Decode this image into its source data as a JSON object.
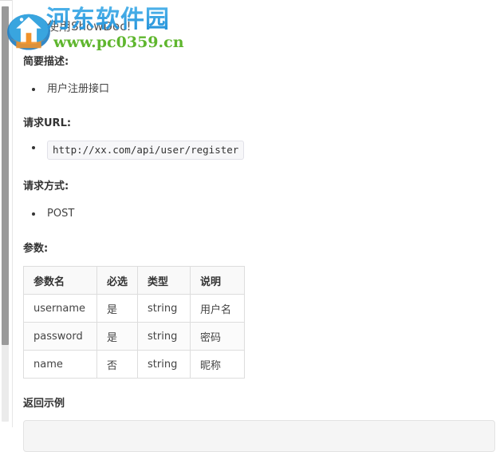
{
  "window": {
    "background": "#ffffff",
    "scrollbar": {
      "name": "vertical-scrollbar",
      "track_color": "#ebebeb",
      "thumb_color": "#9a9a9a"
    }
  },
  "document": {
    "page_title": "欢迎使用ShowDoc!",
    "sections": [
      {
        "heading": "简要描述:",
        "items": [
          "用户注册接口"
        ]
      },
      {
        "heading": "请求URL:",
        "code_items": [
          "http://xx.com/api/user/register"
        ]
      },
      {
        "heading": "请求方式:",
        "items": [
          "POST"
        ]
      },
      {
        "heading": "参数:"
      }
    ],
    "params_table": {
      "headers": [
        "参数名",
        "必选",
        "类型",
        "说明"
      ],
      "rows": [
        [
          "username",
          "是",
          "string",
          "用户名"
        ],
        [
          "password",
          "是",
          "string",
          "密码"
        ],
        [
          "name",
          "否",
          "string",
          "昵称"
        ]
      ]
    },
    "return_example": {
      "heading": "返回示例",
      "code": ""
    }
  },
  "watermark": {
    "brand_text": "河东软件园",
    "brand_color": "#2e9ae0",
    "url_text": "www.pc0359.cn",
    "url_color": "#5fb62e",
    "logo_name": "hedong-software-logo"
  }
}
